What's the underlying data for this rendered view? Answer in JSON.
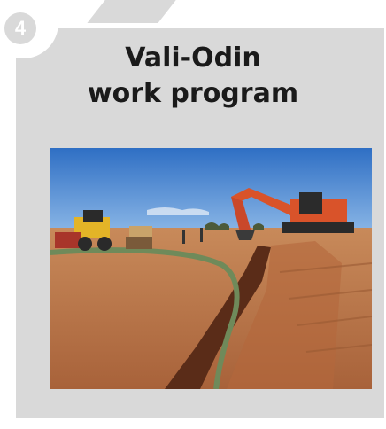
{
  "step": {
    "number": "4"
  },
  "card": {
    "title_line1": "Vali-Odin",
    "title_line2": "work program"
  },
  "photo": {
    "icon": "construction-site-photo",
    "scene": "excavator-and-trench"
  },
  "colors": {
    "card_bg": "#d9d9d9",
    "title": "#1a1a1a",
    "step_badge": "#d9d9d9"
  }
}
